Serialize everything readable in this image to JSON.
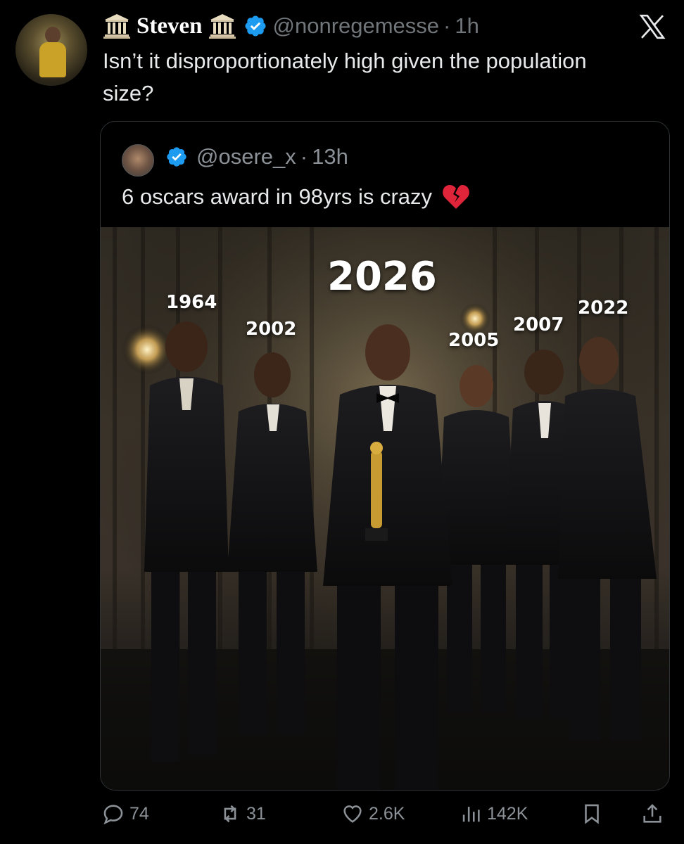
{
  "tweet": {
    "name": "Steven",
    "handle": "@nonregemesse",
    "separator": "·",
    "time": "1h",
    "text": "Isn’t it disproportionately high given the population size?"
  },
  "quoted": {
    "handle": "@osere_x",
    "separator": "·",
    "time": "13h",
    "text": "6 oscars award in 98yrs is crazy",
    "image": {
      "main_year": "2026",
      "years": [
        "1964",
        "2002",
        "2005",
        "2007",
        "2022"
      ]
    }
  },
  "actions": {
    "replies": "74",
    "reposts": "31",
    "likes": "2.6K",
    "views": "142K"
  },
  "colors": {
    "background": "#000000",
    "text": "#e7e9ea",
    "muted": "#71767b",
    "verified": "#1d9bf0",
    "border": "#2f3336"
  },
  "icons": {
    "pillar": "classical-building-icon",
    "verified": "verified-badge-icon",
    "close": "x-logo-icon",
    "heart": "broken-heart-icon"
  }
}
